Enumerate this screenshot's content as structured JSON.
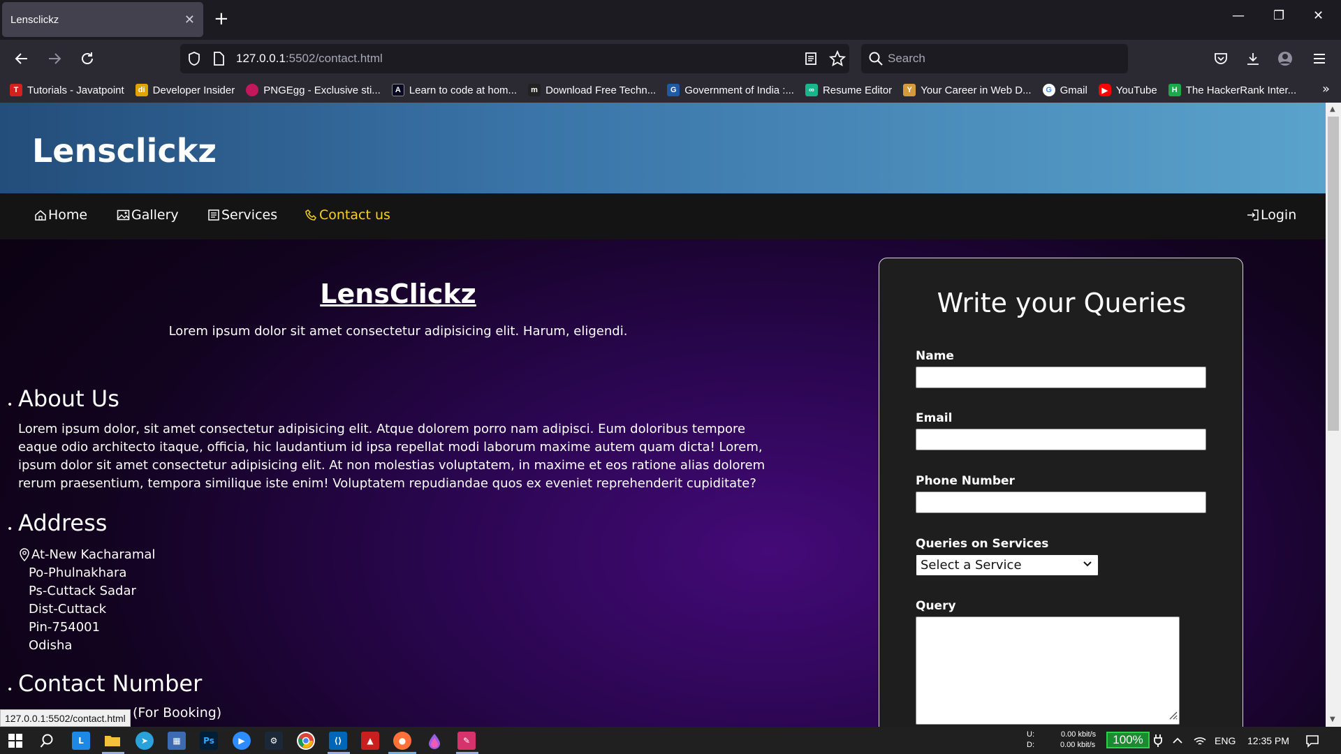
{
  "browser": {
    "tab_title": "Lensclickz",
    "url_host": "127.0.0.1",
    "url_rest": ":5502/contact.html",
    "search_placeholder": "Search",
    "bookmarks": [
      {
        "label": "Tutorials - Javatpoint",
        "icon": "javatpoint-icon",
        "color": "#d4211f"
      },
      {
        "label": "Developer Insider",
        "icon": "developer-insider-icon",
        "color": "#e0a400"
      },
      {
        "label": "PNGEgg - Exclusive sti...",
        "icon": "pngegg-icon",
        "color": "#c2185b"
      },
      {
        "label": "Learn to code at hom...",
        "icon": "freecodecamp-icon",
        "color": "#0a0a23"
      },
      {
        "label": "Download Free Techn...",
        "icon": "m-icon",
        "color": "#222"
      },
      {
        "label": "Government of India :...",
        "icon": "gov-india-icon",
        "color": "#1f5aa6"
      },
      {
        "label": "Resume Editor",
        "icon": "resume-editor-icon",
        "color": "#1ab68b"
      },
      {
        "label": "Your Career in Web D...",
        "icon": "career-icon",
        "color": "#d69a3a"
      },
      {
        "label": "Gmail",
        "icon": "google-icon",
        "color": "#ffffff"
      },
      {
        "label": "YouTube",
        "icon": "youtube-icon",
        "color": "#ff0000"
      },
      {
        "label": "The HackerRank Inter...",
        "icon": "hackerrank-icon",
        "color": "#1ba94c"
      }
    ],
    "status_url": "127.0.0.1:5502/contact.html"
  },
  "site": {
    "logo": "Lensclickz",
    "nav": {
      "home": "Home",
      "gallery": "Gallery",
      "services": "Services",
      "contact": "Contact us",
      "login": "Login"
    },
    "hero_title": "LensClickz",
    "hero_sub": "Lorem ipsum dolor sit amet consectetur adipisicing elit. Harum, eligendi.",
    "about_title": "About Us",
    "about_text": "Lorem ipsum dolor, sit amet consectetur adipisicing elit. Atque dolorem porro nam adipisci. Eum doloribus tempore eaque odio architecto itaque, officia, hic laudantium id ipsa repellat modi laborum maxime autem quam dicta! Lorem, ipsum dolor sit amet consectetur adipisicing elit. At non molestias voluptatem, in maxime et eos ratione alias dolorem rerum praesentium, tempora similique iste enim! Voluptatem repudiandae quos ex eveniet reprehenderit cupiditate?",
    "address_title": "Address",
    "address_lines": [
      "At-New Kacharamal",
      "Po-Phulnakhara",
      "Ps-Cuttack Sadar",
      "Dist-Cuttack",
      "Pin-754001",
      "Odisha"
    ],
    "contact_title": "Contact Number",
    "contact_partial": "(For Booking)"
  },
  "form": {
    "title": "Write your Queries",
    "name_label": "Name",
    "email_label": "Email",
    "phone_label": "Phone Number",
    "service_label": "Queries on Services",
    "service_selected": "Select a Service",
    "query_label": "Query"
  },
  "taskbar": {
    "net_up_label": "U:",
    "net_down_label": "D:",
    "net_up": "0.00 kbit/s",
    "net_down": "0.00 kbit/s",
    "battery": "100%",
    "lang": "ENG",
    "time": "12:35 PM"
  }
}
